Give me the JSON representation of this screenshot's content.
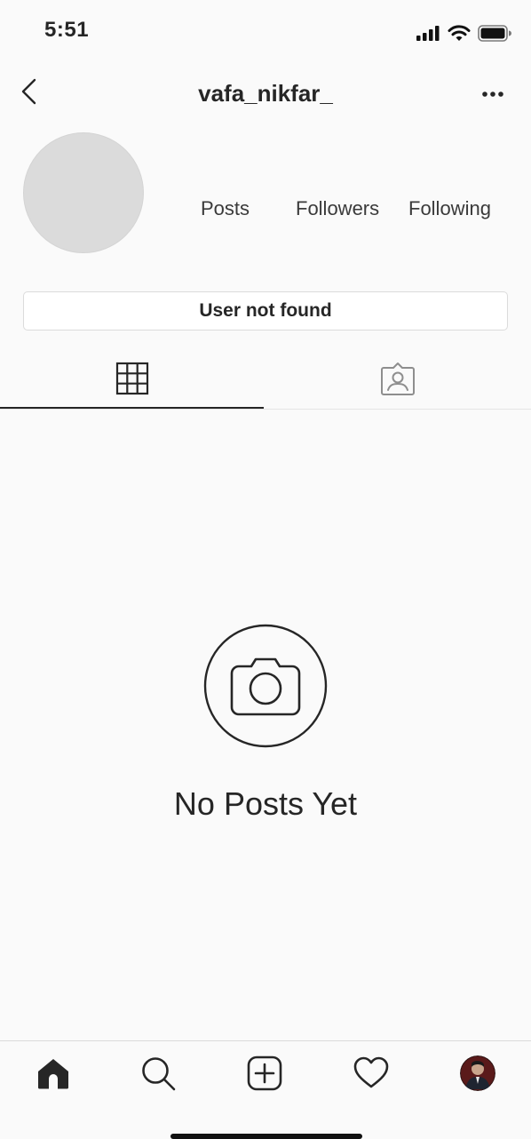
{
  "status_bar": {
    "time": "5:51",
    "icons": [
      "signal-icon",
      "wifi-icon",
      "battery-icon"
    ]
  },
  "header": {
    "username": "vafa_nikfar_",
    "back_icon": "chevron-left-icon",
    "more_icon": "more-horizontal-icon"
  },
  "profile": {
    "stats": {
      "posts_label": "Posts",
      "followers_label": "Followers",
      "following_label": "Following"
    },
    "status_message": "User not found"
  },
  "tabs": [
    {
      "name": "grid",
      "icon": "grid-icon",
      "active": true
    },
    {
      "name": "tagged",
      "icon": "tagged-user-icon",
      "active": false
    }
  ],
  "empty_state": {
    "icon": "camera-icon",
    "text": "No Posts Yet"
  },
  "bottom_nav": [
    {
      "name": "home",
      "icon": "home-icon",
      "active": true
    },
    {
      "name": "search",
      "icon": "search-icon"
    },
    {
      "name": "add",
      "icon": "add-post-icon"
    },
    {
      "name": "activity",
      "icon": "heart-icon"
    },
    {
      "name": "profile",
      "icon": "profile-avatar"
    }
  ],
  "colors": {
    "background": "#fafafa",
    "text": "#262626",
    "placeholder_avatar": "#dbdbdb",
    "border": "#dbdbdb"
  }
}
